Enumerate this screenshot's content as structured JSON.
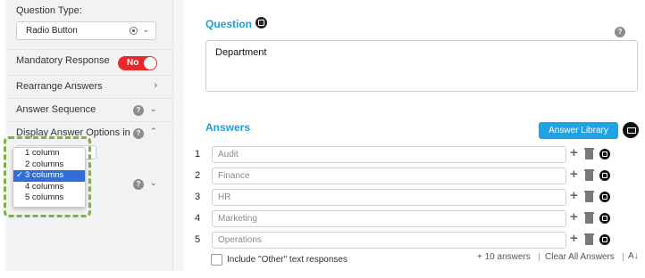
{
  "left": {
    "question_type_label": "Question Type:",
    "question_type_value": "Radio Button",
    "mandatory_label": "Mandatory Response",
    "mandatory_toggle": "No",
    "rearrange_label": "Rearrange Answers",
    "sequence_label": "Answer Sequence",
    "display_label": "Display Answer Options in",
    "help_glyph": "?",
    "column_options": [
      "1 column",
      "2 columns",
      "3 columns",
      "4 columns",
      "5 columns"
    ],
    "selected_option": "3 columns",
    "check_glyph": "✓"
  },
  "right": {
    "question_title": "Question",
    "question_text": "Department",
    "answers_title": "Answers",
    "answer_library_button": "Answer Library",
    "answers": [
      {
        "num": "1",
        "text": "Audit"
      },
      {
        "num": "2",
        "text": "Finance"
      },
      {
        "num": "3",
        "text": "HR"
      },
      {
        "num": "4",
        "text": "Marketing"
      },
      {
        "num": "5",
        "text": "Operations"
      }
    ],
    "include_other": "Include \"Other\" text responses",
    "add_ten_answers": "+ 10 answers",
    "clear_all": "Clear All Answers",
    "separator": "|",
    "sort_glyph": "A↓"
  },
  "colors": {
    "accent": "#1aa0d8",
    "toggle_red": "#e8282a",
    "dashed_highlight": "#7cb342",
    "selection_blue": "#2f6fd7"
  }
}
